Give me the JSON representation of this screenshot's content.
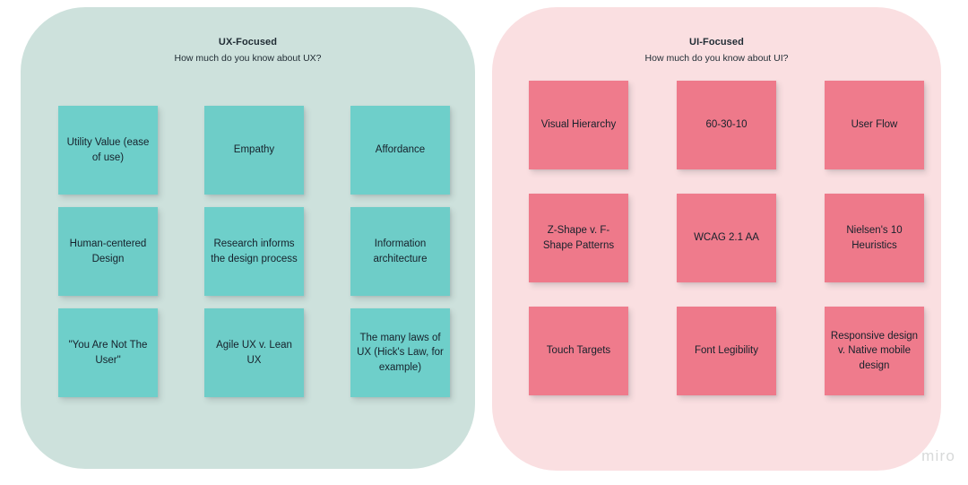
{
  "board": {
    "watermark": "miro",
    "colors": {
      "ux_panel_bg": "#cde1dc",
      "ui_panel_bg": "#fadfe1",
      "ux_note": "#6ecfca",
      "ui_note": "#ef7b8c",
      "note_text": "#16212b",
      "watermark": "#d7d9d9",
      "canvas": "#ffffff"
    }
  },
  "panels": [
    {
      "id": "ux",
      "title": "UX-Focused",
      "subtitle": "How much do you know about UX?",
      "rows": [
        [
          {
            "text": "Utility Value (ease of use)"
          },
          {
            "text": "Empathy"
          },
          {
            "text": "Affordance"
          }
        ],
        [
          {
            "text": "Human-centered Design"
          },
          {
            "text": "Research informs the design process"
          },
          {
            "text": "Information architecture"
          }
        ],
        [
          {
            "text": "\"You Are Not The User\""
          },
          {
            "text": "Agile UX v. Lean UX"
          },
          {
            "text": "The many laws of UX (Hick's Law, for example)"
          }
        ]
      ]
    },
    {
      "id": "ui",
      "title": "UI-Focused",
      "subtitle": "How much do you know about UI?",
      "rows": [
        [
          {
            "text": "Visual Hierarchy"
          },
          {
            "text": "60-30-10"
          },
          {
            "text": "User Flow"
          }
        ],
        [
          {
            "text": "Z-Shape v. F-Shape Patterns"
          },
          {
            "text": "WCAG 2.1 AA"
          },
          {
            "text": "Nielsen's 10 Heuristics"
          }
        ],
        [
          {
            "text": "Touch Targets"
          },
          {
            "text": "Font Legibility"
          },
          {
            "text": "Responsive design v. Native mobile design"
          }
        ]
      ]
    }
  ]
}
